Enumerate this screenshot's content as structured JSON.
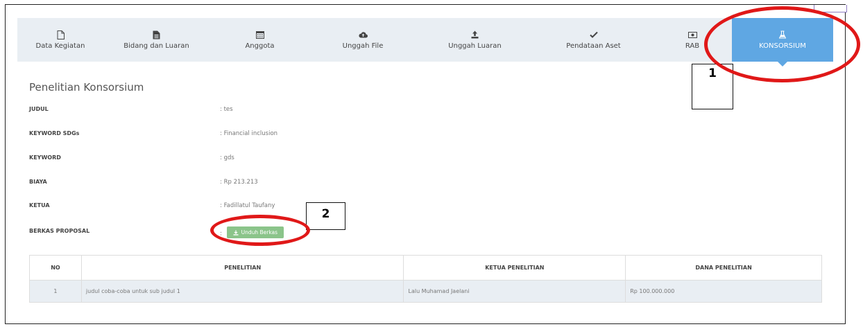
{
  "tabs": [
    {
      "label": "Data Kegiatan",
      "icon": "file-icon"
    },
    {
      "label": "Bidang dan Luaran",
      "icon": "document-icon"
    },
    {
      "label": "Anggota",
      "icon": "calendar-icon"
    },
    {
      "label": "Unggah File",
      "icon": "cloud-upload-icon"
    },
    {
      "label": "Unggah Luaran",
      "icon": "upload-icon"
    },
    {
      "label": "Pendataan Aset",
      "icon": "check-icon"
    },
    {
      "label": "RAB",
      "icon": "money-icon"
    },
    {
      "label": "KONSORSIUM",
      "icon": "flask-icon",
      "active": true
    }
  ],
  "page_title": "Penelitian Konsorsium",
  "details": [
    {
      "label": "JUDUL",
      "value": ": tes"
    },
    {
      "label": "KEYWORD SDGs",
      "value": ": Financial inclusion"
    },
    {
      "label": "KEYWORD",
      "value": ": gds"
    },
    {
      "label": "BIAYA",
      "value": ": Rp 213.213"
    },
    {
      "label": "KETUA",
      "value": ": Fadillatul Taufany"
    },
    {
      "label": "BERKAS PROPOSAL",
      "value": ":"
    }
  ],
  "download_button": "Unduh Berkas",
  "table": {
    "headers": [
      "NO",
      "PENELITIAN",
      "KETUA PENELITIAN",
      "DANA PENELITIAN"
    ],
    "rows": [
      [
        "1",
        "judul coba-coba untuk sub judul 1",
        "Lalu Muhamad Jaelani",
        "Rp 100.000.000"
      ]
    ]
  },
  "annotations": {
    "box1": "1",
    "box2": "2",
    "highlight_color": "#e01818"
  }
}
